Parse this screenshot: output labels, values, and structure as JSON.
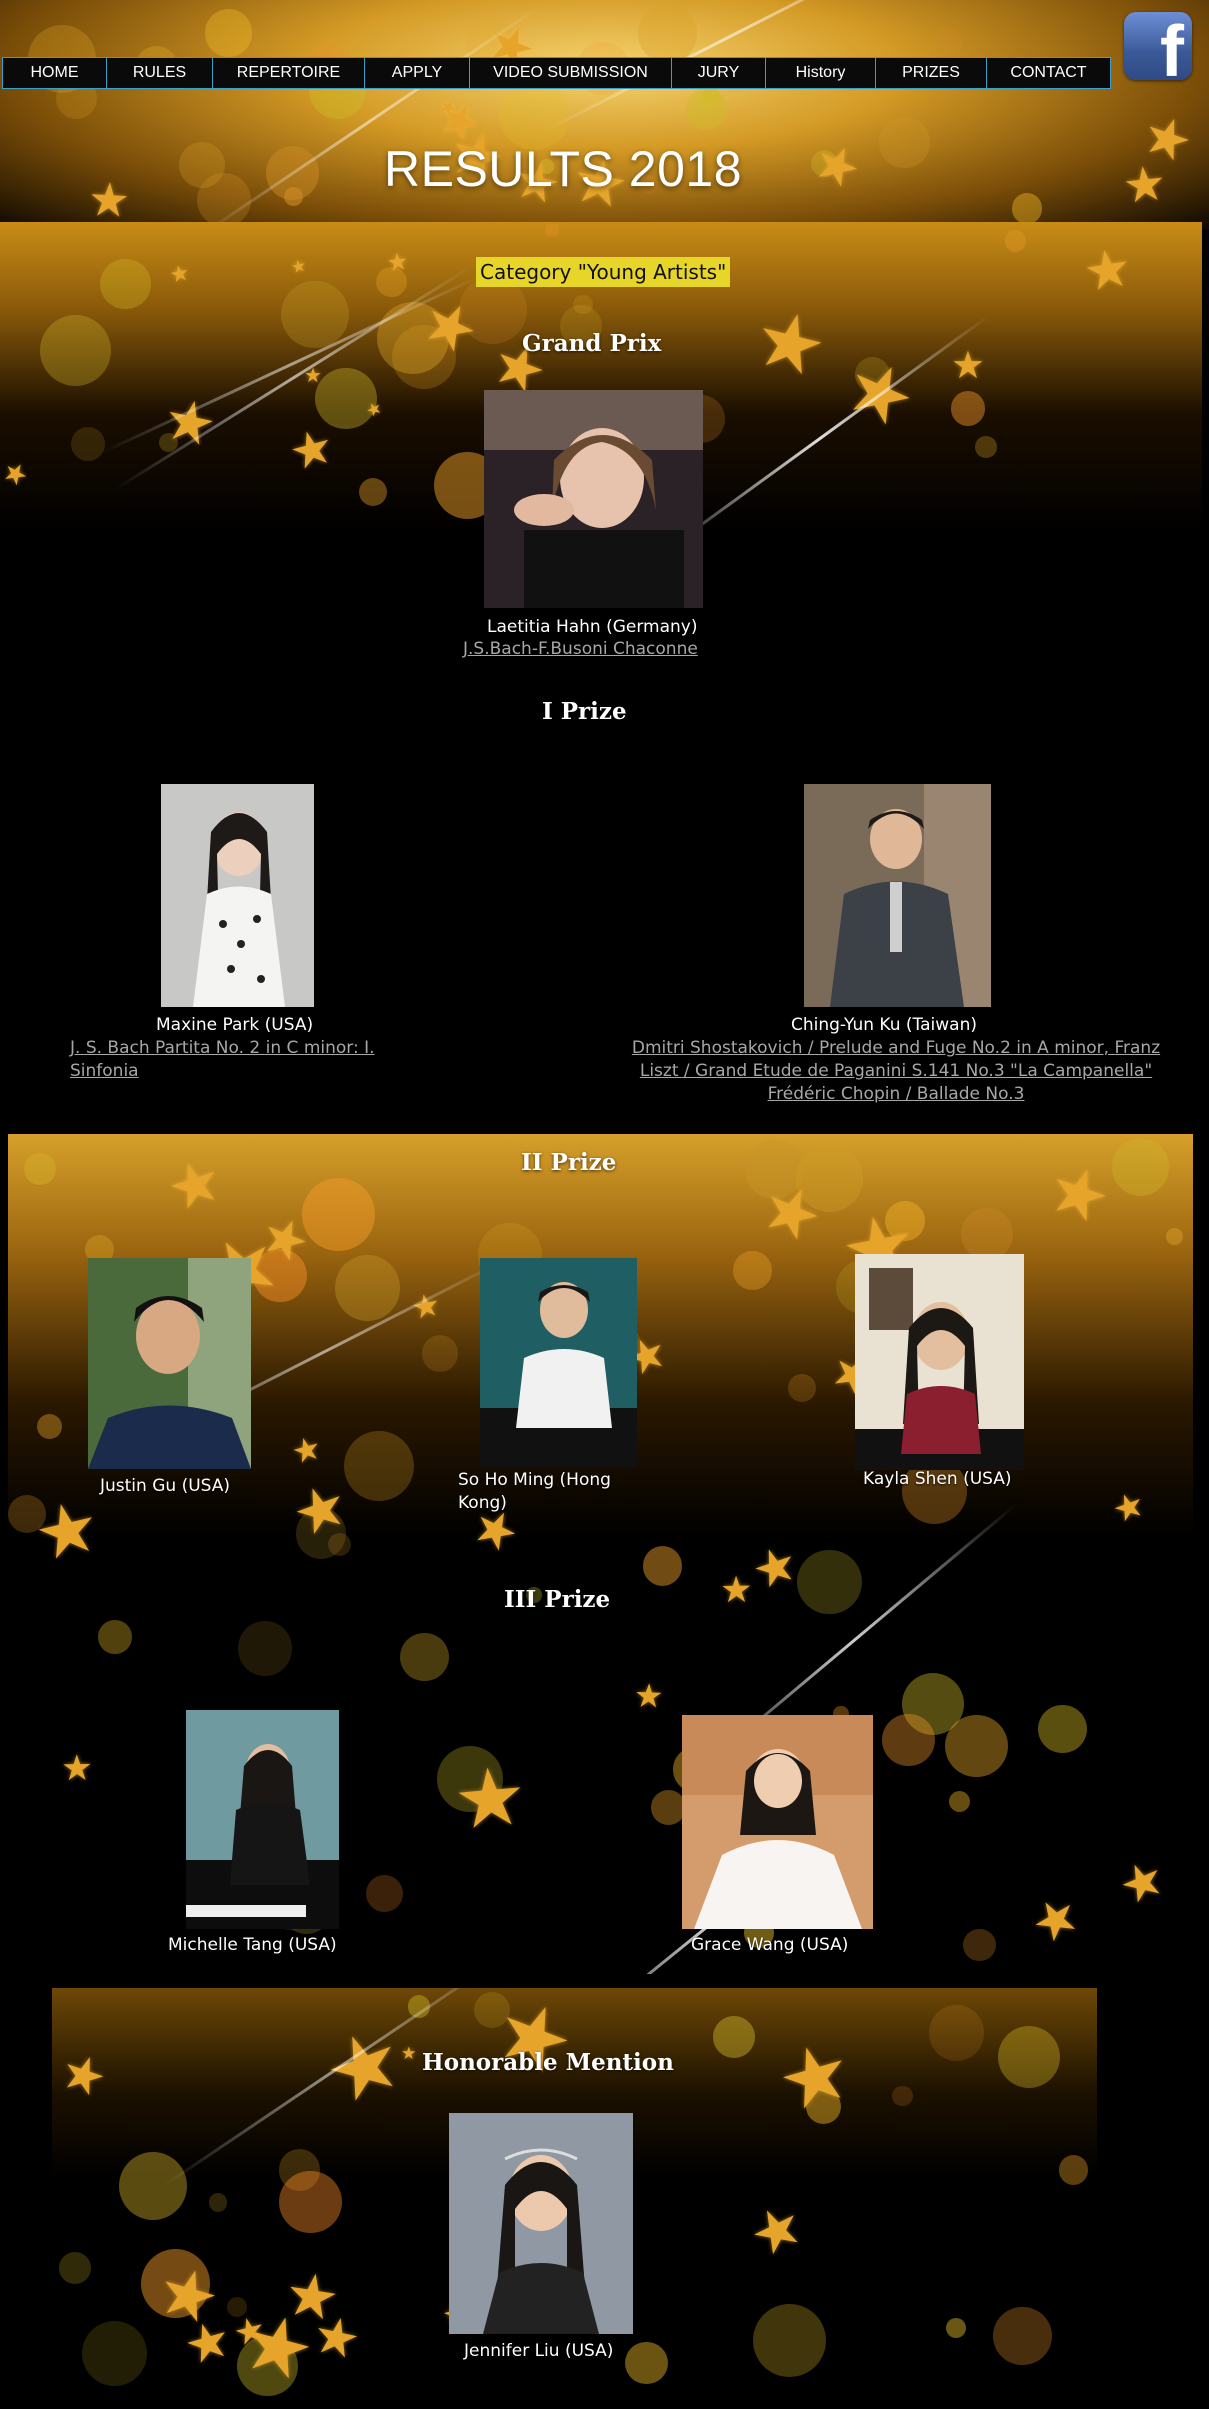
{
  "nav": {
    "items": [
      "HOME",
      "RULES",
      "REPERTOIRE",
      "APPLY",
      "VIDEO SUBMISSION",
      "JURY",
      "History",
      "PRIZES",
      "CONTACT"
    ]
  },
  "social": {
    "facebook_letter": "f",
    "facebook_color": "#3b5998"
  },
  "page_title": "RESULTS 2018",
  "category": "Category \"Young Artists\"",
  "accent_color": "#e7d52a",
  "grand_prix": {
    "title": "Grand Prix",
    "winner": {
      "name": "Laetitia Hahn (Germany)",
      "piece": "J.S.Bach-F.Busoni Chaconne "
    }
  },
  "first_prize": {
    "title": "I Prize",
    "winners": [
      {
        "name": "Maxine Park (USA)",
        "piece": "J. S. Bach Partita No. 2 in C minor: I. Sinfonia"
      },
      {
        "name": "Ching-Yun Ku (Taiwan)",
        "piece": "Dmitri Shostakovich / Prelude and Fuge No.2 in A minor, Franz Liszt / Grand Etude de Paganini S.141 No.3 \"La Campanella\" Frédéric Chopin / Ballade No.3 "
      }
    ]
  },
  "second_prize": {
    "title": "II Prize",
    "winners": [
      {
        "name": "Justin Gu (USA)"
      },
      {
        "name": "So Ho Ming (Hong Kong)"
      },
      {
        "name": "Kayla Shen (USA)"
      }
    ]
  },
  "third_prize": {
    "title": "III Prize",
    "winners": [
      {
        "name": "Michelle Tang (USA)"
      },
      {
        "name": "Grace Wang (USA)"
      }
    ]
  },
  "honorable_mention": {
    "title": "Honorable Mention",
    "winners": [
      {
        "name": "Jennifer Liu (USA)"
      }
    ]
  }
}
